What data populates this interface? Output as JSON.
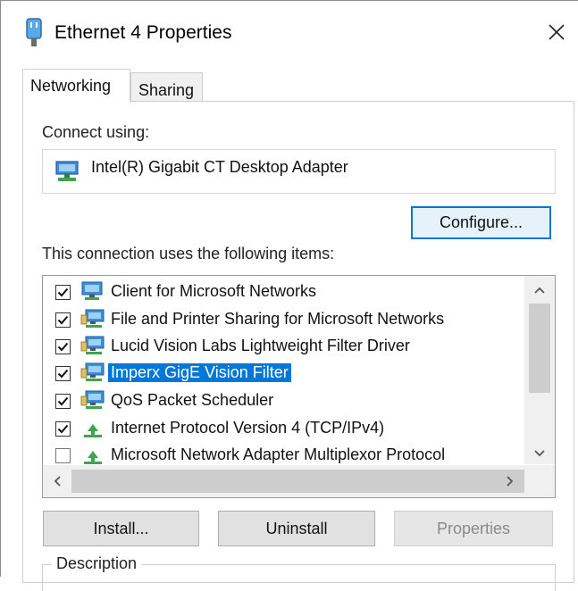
{
  "window": {
    "title": "Ethernet 4 Properties"
  },
  "tabs": [
    {
      "label": "Networking",
      "active": true
    },
    {
      "label": "Sharing",
      "active": false
    }
  ],
  "connect": {
    "label": "Connect using:",
    "adapter": "Intel(R) Gigabit CT Desktop Adapter",
    "configure_label": "Configure..."
  },
  "items": {
    "label": "This connection uses the following items:",
    "list": [
      {
        "label": "Client for Microsoft Networks",
        "checked": true,
        "icon": "network-client-icon",
        "selected": false
      },
      {
        "label": "File and Printer Sharing for Microsoft Networks",
        "checked": true,
        "icon": "network-service-icon",
        "selected": false
      },
      {
        "label": "Lucid Vision Labs Lightweight Filter Driver",
        "checked": true,
        "icon": "network-service-icon",
        "selected": false
      },
      {
        "label": "Imperx GigE Vision Filter",
        "checked": true,
        "icon": "network-service-icon",
        "selected": true
      },
      {
        "label": "QoS Packet Scheduler",
        "checked": true,
        "icon": "network-service-icon",
        "selected": false
      },
      {
        "label": "Internet Protocol Version 4 (TCP/IPv4)",
        "checked": true,
        "icon": "protocol-icon",
        "selected": false
      },
      {
        "label": "Microsoft Network Adapter Multiplexor Protocol",
        "checked": false,
        "icon": "protocol-icon",
        "selected": false
      }
    ]
  },
  "buttons": {
    "install": "Install...",
    "uninstall": "Uninstall",
    "properties": "Properties"
  },
  "description": {
    "label": "Description"
  },
  "colors": {
    "accent": "#0078d7",
    "selection": "#0078d7"
  }
}
